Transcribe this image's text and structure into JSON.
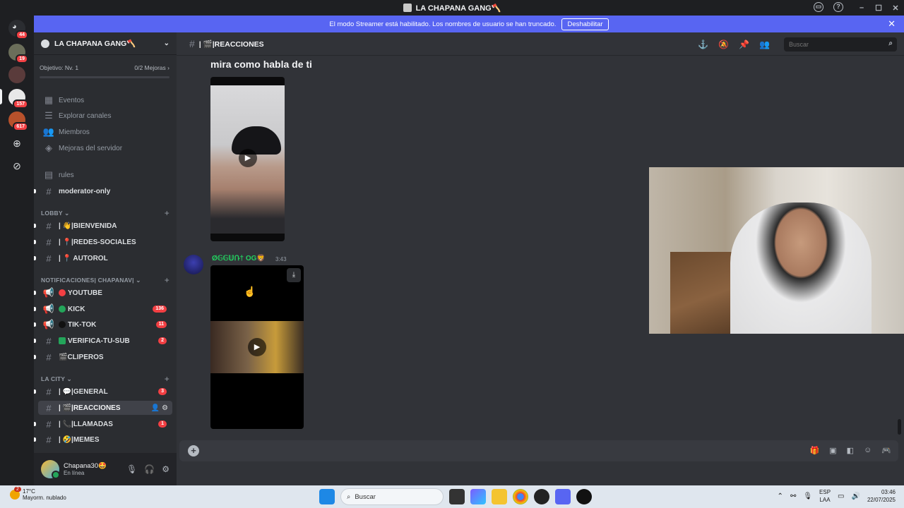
{
  "window": {
    "title": "LA CHAPANA GANG🪓"
  },
  "banner": {
    "text": "El modo Streamer está habilitado. Los nombres de usuario se han truncado.",
    "button": "Deshabilitar"
  },
  "rail": {
    "badges": [
      "44",
      "19",
      "157",
      "617"
    ]
  },
  "server": {
    "name": "LA CHAPANA GANG🪓",
    "goal_label": "Objetivo: Nv. 1",
    "goal_progress": "0/2 Mejoras",
    "goal_fraction": 0.0,
    "menu": [
      "Eventos",
      "Explorar canales",
      "Miembros",
      "Mejoras del servidor"
    ]
  },
  "channels": {
    "top": [
      {
        "name": "rules",
        "badge": ""
      },
      {
        "name": "moderator-only",
        "badge": ""
      }
    ],
    "lobby_label": "LOBBY",
    "lobby": [
      {
        "name": "| 👋|BIENVENIDA",
        "badge": ""
      },
      {
        "name": "| 📍|REDES-SOCIALES",
        "badge": ""
      },
      {
        "name": "| 📍 AUTOROL",
        "badge": ""
      }
    ],
    "notif_label": "NOTIFICACIONES| CHAPANAV|",
    "notif": [
      {
        "name": "YOUTUBE",
        "badge": ""
      },
      {
        "name": "KICK",
        "badge": "136"
      },
      {
        "name": "TIK-TOK",
        "badge": "11"
      },
      {
        "name": "VERIFICA-TU-SUB",
        "badge": "2"
      },
      {
        "name": "🎬CLIPEROS",
        "badge": ""
      }
    ],
    "city_label": "LA CITY",
    "city": [
      {
        "name": "| 💬|GENERAL",
        "badge": "3"
      },
      {
        "name": "| 🎬|REACCIONES",
        "badge": ""
      },
      {
        "name": "| 📞|LLAMADAS",
        "badge": "1"
      },
      {
        "name": "| 🤣|MEMES",
        "badge": ""
      }
    ]
  },
  "user": {
    "name": "Chapana30🤩",
    "status": "En línea"
  },
  "chat": {
    "channel": "| 🎬|REACCIONES",
    "search_placeholder": "Buscar",
    "message1": "mira como habla de ti",
    "author": "Ø𝔾𝔾𝕌Ռ† OG🦁",
    "time": "3:43"
  },
  "taskbar": {
    "weather_badge": "2",
    "temperature": "17°C",
    "condition": "Mayorm. nublado",
    "search": "Buscar",
    "lang1": "ESP",
    "lang2": "LAA",
    "time": "03:46",
    "date": "22/07/2025"
  }
}
